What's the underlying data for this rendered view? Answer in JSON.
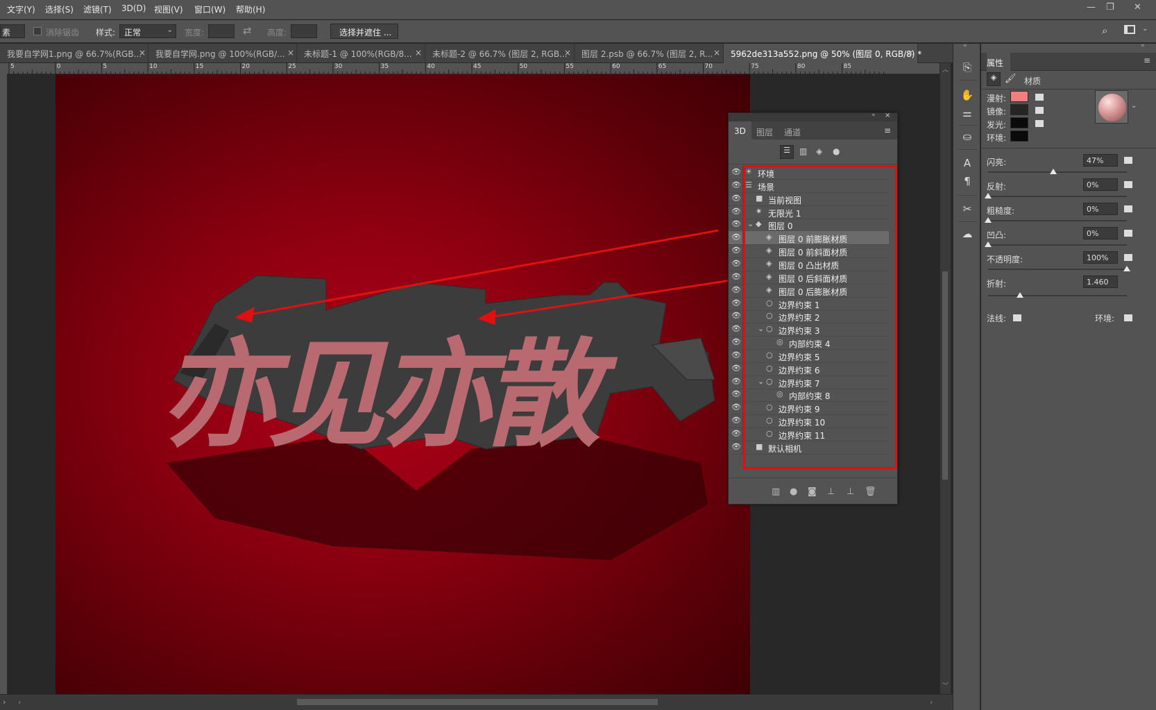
{
  "menu": [
    "文字(Y)",
    "选择(S)",
    "滤镜(T)",
    "3D(D)",
    "视图(V)",
    "窗口(W)",
    "帮助(H)"
  ],
  "window_controls": [
    "—",
    "❐",
    "✕"
  ],
  "options_bar": {
    "pixel_label": "素",
    "anti_alias": "消除锯齿",
    "style_label": "样式:",
    "style_value": "正常",
    "width_label": "宽度:",
    "height_label": "高度:",
    "select_mask_button": "选择并遮住 ..."
  },
  "tabs": [
    {
      "label": "我要自学网1.png @ 66.7%(RGB...",
      "active": false
    },
    {
      "label": "我要自学网.png @ 100%(RGB/...",
      "active": false
    },
    {
      "label": "未标题-1 @ 100%(RGB/8...",
      "active": false
    },
    {
      "label": "未标题-2 @ 66.7% (图层 2, RGB...",
      "active": false
    },
    {
      "label": "图层 2.psb @ 66.7% (图层 2, R...",
      "active": false
    },
    {
      "label": "5962de313a552.png @ 50% (图层 0, RGB/8) *",
      "active": true
    }
  ],
  "ruler_ticks": [
    "5",
    "0",
    "5",
    "10",
    "15",
    "20",
    "25",
    "30",
    "35",
    "40",
    "45",
    "50",
    "55",
    "60",
    "65",
    "70",
    "75",
    "80",
    "85"
  ],
  "panel3d": {
    "tabs": [
      "3D",
      "图层",
      "通道"
    ],
    "rows": [
      {
        "label": "环境",
        "indent": 0,
        "icon": "env-icon",
        "selected": false
      },
      {
        "label": "场景",
        "indent": 0,
        "icon": "scene-icon",
        "selected": false
      },
      {
        "label": "当前视图",
        "indent": 1,
        "icon": "camera-icon",
        "selected": false
      },
      {
        "label": "无限光 1",
        "indent": 1,
        "icon": "light-icon",
        "selected": false
      },
      {
        "label": "图层 0",
        "indent": 1,
        "icon": "mesh-icon",
        "selected": false,
        "expanded": true
      },
      {
        "label": "图层 0 前膨胀材质",
        "indent": 2,
        "icon": "material-icon",
        "selected": true
      },
      {
        "label": "图层 0 前斜面材质",
        "indent": 2,
        "icon": "material-icon",
        "selected": false
      },
      {
        "label": "图层 0 凸出材质",
        "indent": 2,
        "icon": "material-icon",
        "selected": false
      },
      {
        "label": "图层 0 后斜面材质",
        "indent": 2,
        "icon": "material-icon",
        "selected": false
      },
      {
        "label": "图层 0 后膨胀材质",
        "indent": 2,
        "icon": "material-icon",
        "selected": false
      },
      {
        "label": "边界约束 1",
        "indent": 2,
        "icon": "constraint-icon",
        "selected": false
      },
      {
        "label": "边界约束 2",
        "indent": 2,
        "icon": "constraint-icon",
        "selected": false
      },
      {
        "label": "边界约束 3",
        "indent": 2,
        "icon": "constraint-icon",
        "selected": false,
        "expanded": true
      },
      {
        "label": "内部约束 4",
        "indent": 3,
        "icon": "inner-constraint-icon",
        "selected": false
      },
      {
        "label": "边界约束 5",
        "indent": 2,
        "icon": "constraint-icon",
        "selected": false
      },
      {
        "label": "边界约束 6",
        "indent": 2,
        "icon": "constraint-icon",
        "selected": false
      },
      {
        "label": "边界约束 7",
        "indent": 2,
        "icon": "constraint-icon",
        "selected": false,
        "expanded": true
      },
      {
        "label": "内部约束 8",
        "indent": 3,
        "icon": "inner-constraint-icon",
        "selected": false
      },
      {
        "label": "边界约束 9",
        "indent": 2,
        "icon": "constraint-icon",
        "selected": false
      },
      {
        "label": "边界约束 10",
        "indent": 2,
        "icon": "constraint-icon",
        "selected": false
      },
      {
        "label": "边界约束 11",
        "indent": 2,
        "icon": "constraint-icon",
        "selected": false
      },
      {
        "label": "默认相机",
        "indent": 1,
        "icon": "camera-icon",
        "selected": false
      }
    ]
  },
  "properties": {
    "title": "属性",
    "mode": "材质",
    "diffuse_label": "漫射:",
    "specular_label": "镜像:",
    "illum_label": "发光:",
    "ambient_label": "环境:",
    "diffuse_color": "#f08080",
    "specular_color": "#252525",
    "illum_color": "#0a0a0a",
    "ambient_color": "#0a0a0a",
    "shine_label": "闪亮:",
    "shine_value": "47%",
    "shine": 0.47,
    "reflect_label": "反射:",
    "reflect_value": "0%",
    "reflect": 0,
    "rough_label": "粗糙度:",
    "rough_value": "0%",
    "rough": 0,
    "bump_label": "凹凸:",
    "bump_value": "0%",
    "bump": 0,
    "opacity_label": "不透明度:",
    "opacity_value": "100%",
    "opacity": 1,
    "refract_label": "折射:",
    "refract_value": "1.460",
    "refract": 0.23,
    "normal_label": "法线:",
    "env_label": "环境:"
  },
  "canvas_text": "亦见亦散",
  "colors": {
    "text_face": "#b86a70",
    "text_side": "#3a3a3a",
    "annot_red": "#e01010"
  }
}
